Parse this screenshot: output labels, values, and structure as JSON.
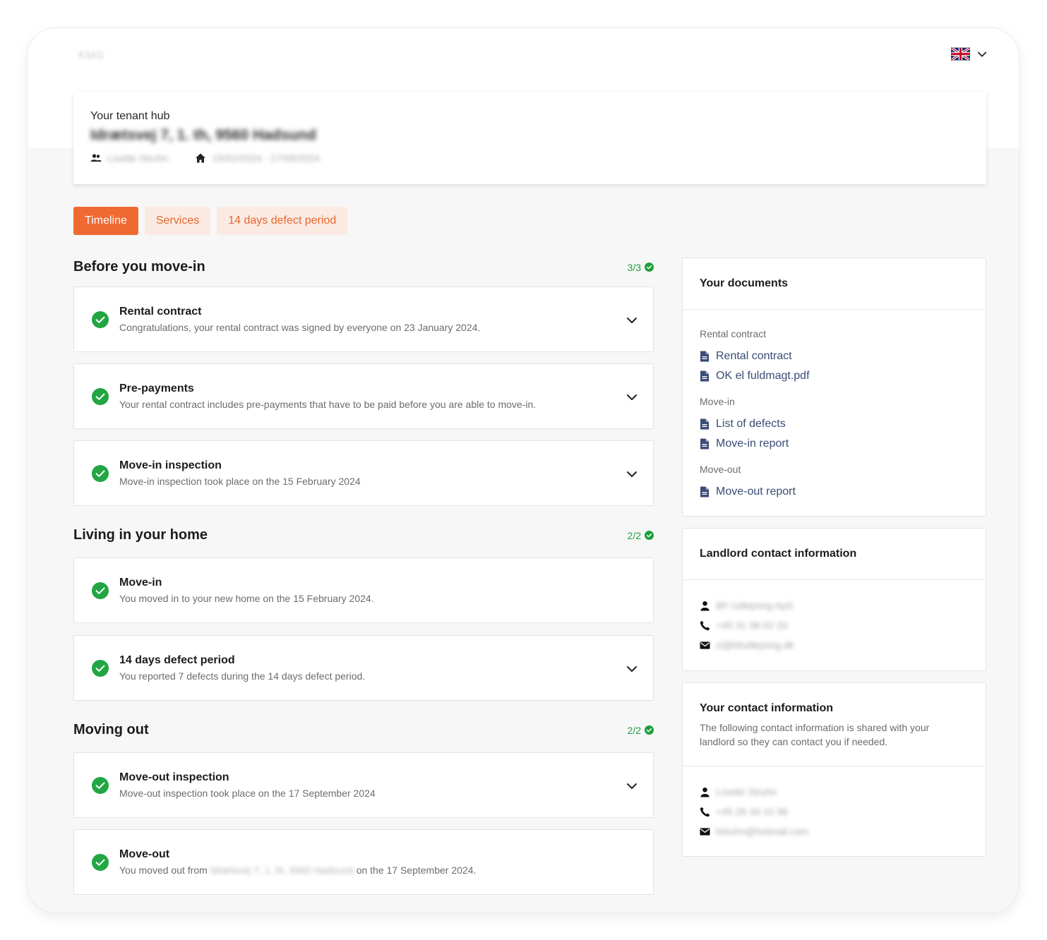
{
  "header": {
    "logo_text": "KMG",
    "language": {
      "flag_icon": "uk-flag-icon",
      "dropdown_icon": "chevron-down-icon"
    }
  },
  "hub": {
    "label": "Your tenant hub",
    "address": "Idrætsvej 7, 1. th, 9560 Hadsund",
    "tenants": "Lisette Struhn",
    "period": "15/02/2024 - 17/09/2024"
  },
  "tabs": [
    {
      "label": "Timeline",
      "active": true
    },
    {
      "label": "Services",
      "active": false
    },
    {
      "label": "14 days defect period",
      "active": false
    }
  ],
  "timeline": {
    "sections": [
      {
        "title": "Before you move-in",
        "count": "3/3",
        "items": [
          {
            "title": "Rental contract",
            "desc": "Congratulations, your rental contract was signed by everyone on 23 January 2024.",
            "expandable": true
          },
          {
            "title": "Pre-payments",
            "desc": "Your rental contract includes pre-payments that have to be paid before you are able to move-in.",
            "expandable": true
          },
          {
            "title": "Move-in inspection",
            "desc": "Move-in inspection took place on the 15 February 2024",
            "expandable": true
          }
        ]
      },
      {
        "title": "Living in your home",
        "count": "2/2",
        "items": [
          {
            "title": "Move-in",
            "desc": "You moved in to your new home on the 15 February 2024.",
            "expandable": false
          },
          {
            "title": "14 days defect period",
            "desc": "You reported 7 defects during the 14 days defect period.",
            "expandable": true
          }
        ]
      },
      {
        "title": "Moving out",
        "count": "2/2",
        "items": [
          {
            "title": "Move-out inspection",
            "desc": "Move-out inspection took place on the 17 September 2024",
            "expandable": true
          },
          {
            "title": "Move-out",
            "desc_prefix": "You moved out from",
            "desc_address": "Idrætsvej 7, 1. th, 9560 Hadsund",
            "desc_suffix": "on the 17 September 2024.",
            "expandable": false
          }
        ]
      }
    ]
  },
  "documents": {
    "title": "Your documents",
    "groups": [
      {
        "label": "Rental contract",
        "files": [
          "Rental contract",
          "OK el fuldmagt.pdf"
        ]
      },
      {
        "label": "Move-in",
        "files": [
          "List of defects",
          "Move-in report"
        ]
      },
      {
        "label": "Move-out",
        "files": [
          "Move-out report"
        ]
      }
    ]
  },
  "landlord": {
    "title": "Landlord contact information",
    "name": "BF Udlejning ApS",
    "phone": "+45 31 38 02 20",
    "email": "cl@bfudlejning.dk"
  },
  "your_contact": {
    "title": "Your contact information",
    "description": "The following contact information is shared with your landlord so they can contact you if needed.",
    "name": "Lisette Struhn",
    "phone": "+45 28 34 10 38",
    "email": "lstruhn@hotmail.com"
  },
  "colors": {
    "accent": "#ef6a33",
    "accent_soft": "#fbeae2",
    "success": "#1f9e3c",
    "link": "#3a4b74"
  }
}
